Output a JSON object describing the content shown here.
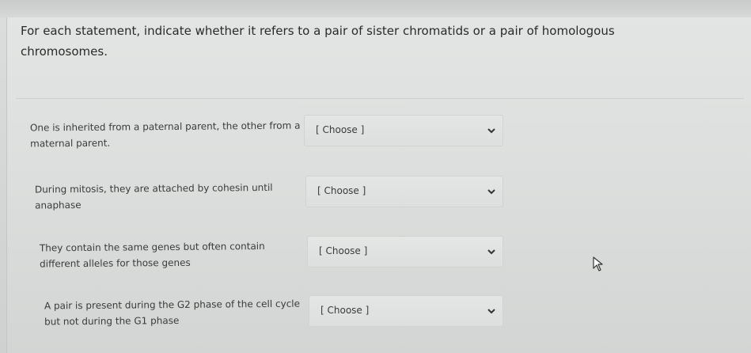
{
  "question": {
    "text": "For each statement, indicate whether it refers to a pair of sister chromatids or a pair of homologous chromosomes."
  },
  "rows": [
    {
      "statement": "One is inherited from a paternal parent, the other from a maternal parent.",
      "selected": "[ Choose ]"
    },
    {
      "statement": "During mitosis, they are attached by cohesin until anaphase",
      "selected": "[ Choose ]"
    },
    {
      "statement": "They contain the same genes but often contain different alleles for those genes",
      "selected": "[ Choose ]"
    },
    {
      "statement": "A pair is present during the G2 phase of the cell cycle but not during the G1 phase",
      "selected": "[ Choose ]"
    }
  ],
  "icons": {
    "dropdown": "chevron-down-icon",
    "pointer": "mouse-cursor-icon"
  },
  "colors": {
    "text": "#2a2a2a",
    "background": "#dcdede"
  }
}
